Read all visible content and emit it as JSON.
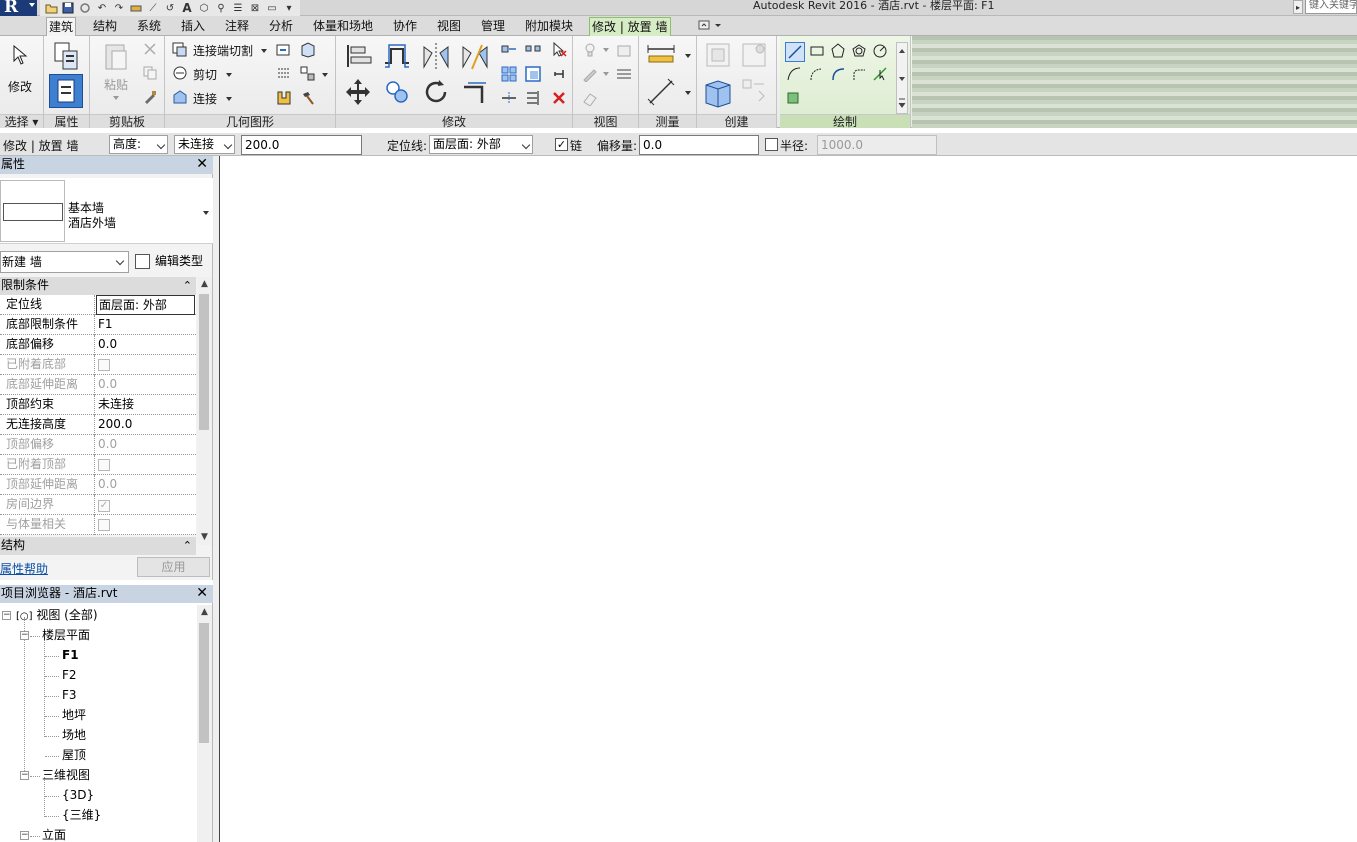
{
  "title": "Autodesk Revit 2016 -     酒店.rvt - 楼层平面: F1",
  "search_placeholder": "键入关键字",
  "tabs": [
    {
      "label": "建筑",
      "active": true
    },
    {
      "label": "结构"
    },
    {
      "label": "系统"
    },
    {
      "label": "插入"
    },
    {
      "label": "注释"
    },
    {
      "label": "分析"
    },
    {
      "label": "体量和场地"
    },
    {
      "label": "协作"
    },
    {
      "label": "视图"
    },
    {
      "label": "管理"
    },
    {
      "label": "附加模块"
    },
    {
      "label": "修改 | 放置 墙",
      "contextual": true
    }
  ],
  "ribbon": {
    "panels": {
      "select": "选择",
      "properties": "属性",
      "clipboard": "剪贴板",
      "geometry": "几何图形",
      "modify": "修改",
      "view": "视图",
      "measure": "测量",
      "create": "创建",
      "draw": "绘制"
    },
    "modify_label": "修改",
    "paste_label": "粘贴",
    "join_cut_label": "连接端切割",
    "cut_label": "剪切",
    "join_label": "连接"
  },
  "options_bar": {
    "context": "修改 | 放置 墙",
    "height_label": "高度:",
    "connection_value": "未连接",
    "height_value": "200.0",
    "location_label": "定位线:",
    "location_value": "面层面: 外部",
    "chain_label": "链",
    "chain_checked": true,
    "offset_label": "偏移量:",
    "offset_value": "0.0",
    "radius_label": "半径:",
    "radius_value": "1000.0",
    "radius_checked": false
  },
  "properties": {
    "title": "属性",
    "type_family": "基本墙",
    "type_name": "酒店外墙",
    "instance_filter": "新建 墙",
    "edit_type": "编辑类型",
    "group_constraints": "限制条件",
    "rows": [
      {
        "key": "定位线",
        "value": "面层面: 外部",
        "enabled": true,
        "selected": true
      },
      {
        "key": "底部限制条件",
        "value": "F1",
        "enabled": true
      },
      {
        "key": "底部偏移",
        "value": "0.0",
        "enabled": true
      },
      {
        "key": "已附着底部",
        "value": "",
        "enabled": false,
        "checkbox": true,
        "checked": false
      },
      {
        "key": "底部延伸距离",
        "value": "0.0",
        "enabled": false
      },
      {
        "key": "顶部约束",
        "value": "未连接",
        "enabled": true
      },
      {
        "key": "无连接高度",
        "value": "200.0",
        "enabled": true
      },
      {
        "key": "顶部偏移",
        "value": "0.0",
        "enabled": false
      },
      {
        "key": "已附着顶部",
        "value": "",
        "enabled": false,
        "checkbox": true,
        "checked": false
      },
      {
        "key": "顶部延伸距离",
        "value": "0.0",
        "enabled": false
      },
      {
        "key": "房间边界",
        "value": "",
        "enabled": false,
        "checkbox": true,
        "checked": true
      },
      {
        "key": "与体量相关",
        "value": "",
        "enabled": false,
        "checkbox": true,
        "checked": false
      }
    ],
    "group_structure": "结构",
    "help_link": "属性帮助",
    "apply": "应用"
  },
  "browser": {
    "title": "项目浏览器 - 酒店.rvt",
    "root": "视图 (全部)",
    "floor_plans": "楼层平面",
    "floor_plan_items": [
      "F1",
      "F2",
      "F3",
      "地坪",
      "场地",
      "屋顶"
    ],
    "active_view": "F1",
    "views_3d": "三维视图",
    "views_3d_items": [
      "{3D}",
      "{三维}"
    ],
    "elevations": "立面"
  }
}
